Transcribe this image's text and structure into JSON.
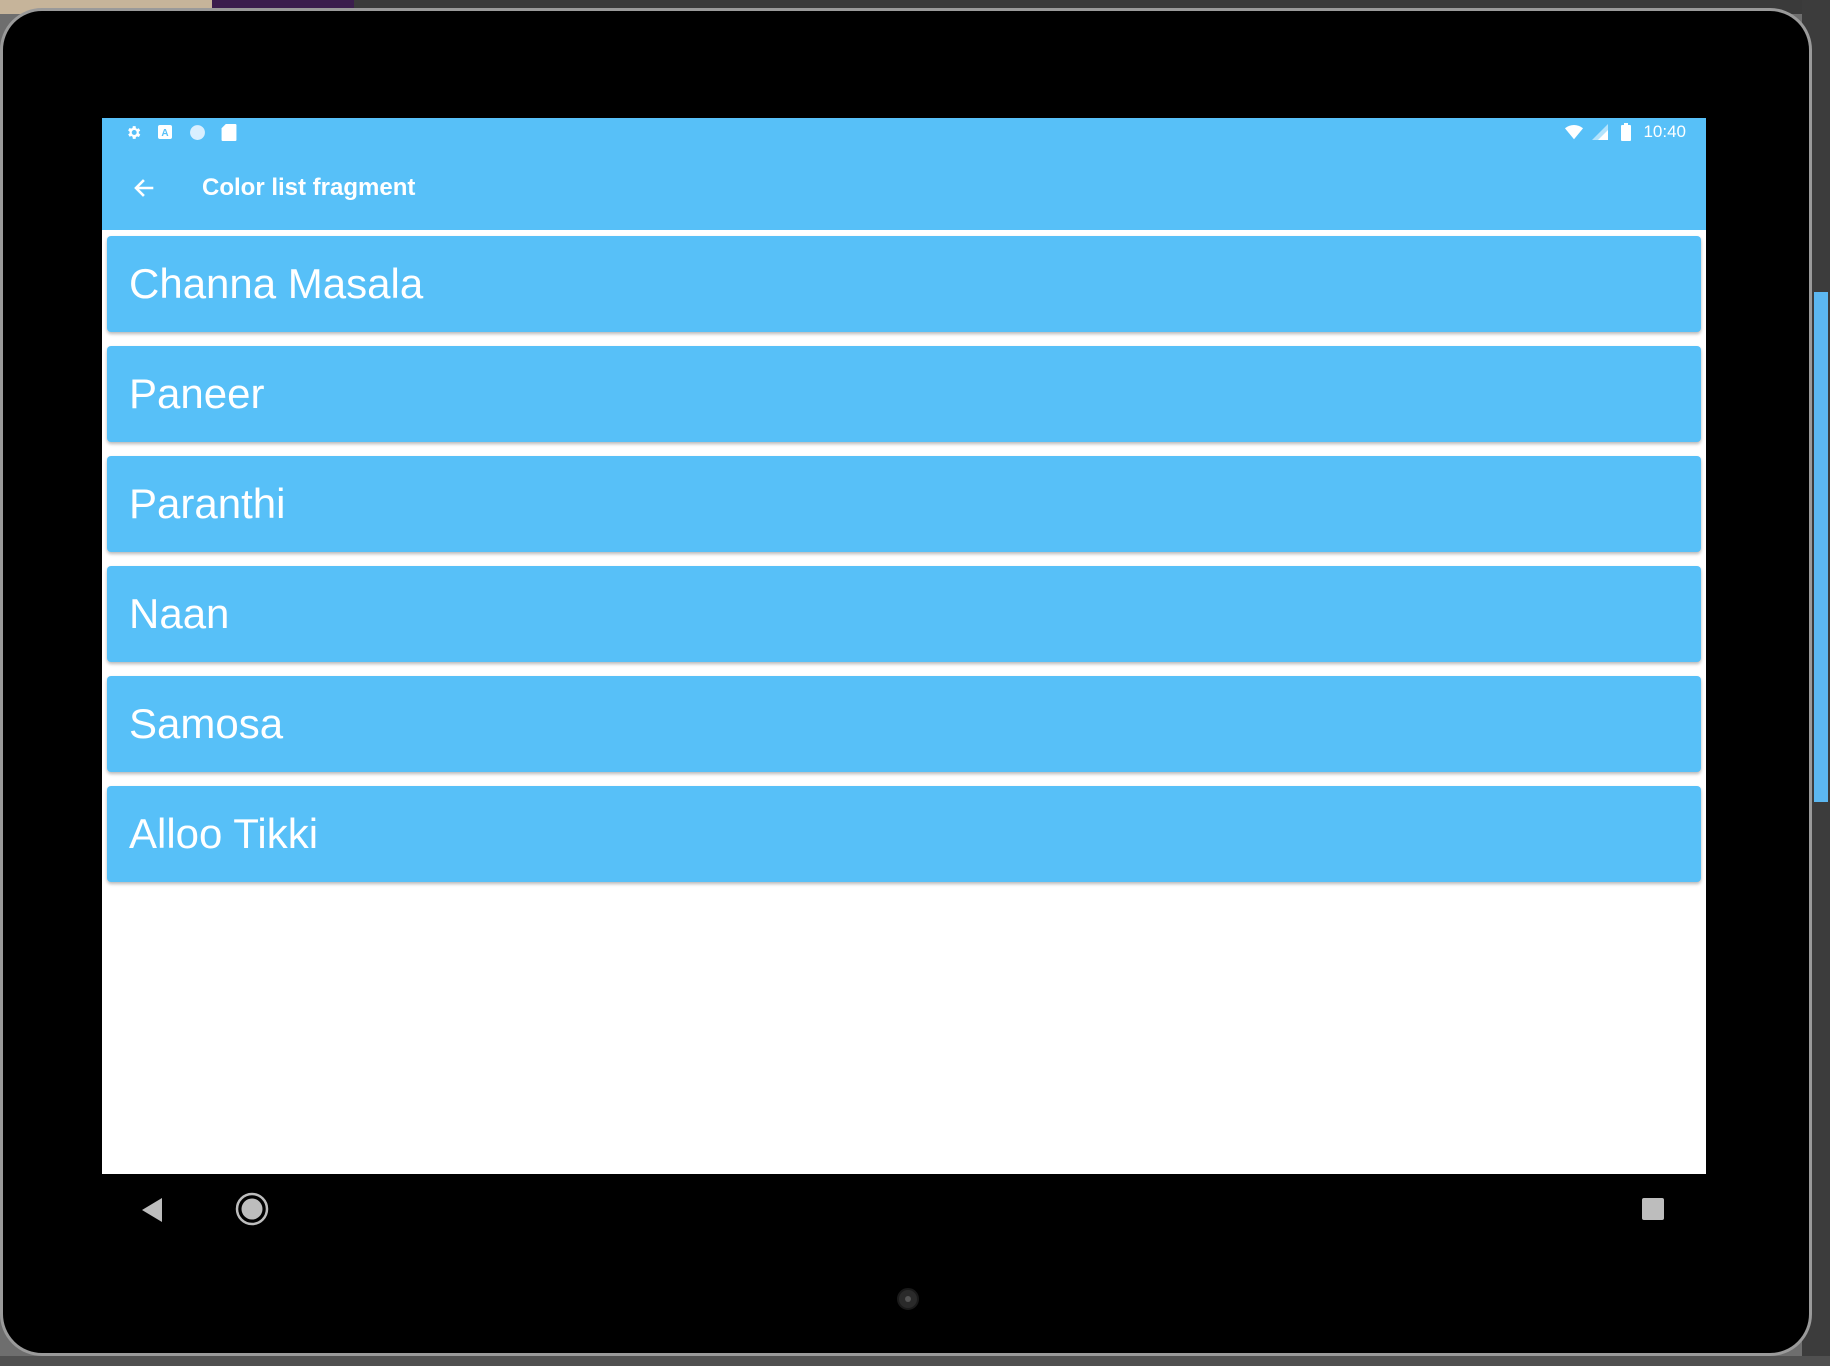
{
  "status_bar": {
    "left_icons": [
      "gear-icon",
      "a-notification-icon",
      "circle-icon",
      "sd-card-icon"
    ],
    "right_icons": [
      "wifi-icon",
      "cell-signal-icon",
      "battery-icon"
    ],
    "time": "10:40"
  },
  "toolbar": {
    "back_icon": "arrow-left-icon",
    "title": "Color list fragment"
  },
  "list": {
    "items": [
      {
        "label": "Channa Masala"
      },
      {
        "label": "Paneer"
      },
      {
        "label": "Paranthi"
      },
      {
        "label": "Naan"
      },
      {
        "label": "Samosa"
      },
      {
        "label": "Alloo Tikki"
      }
    ]
  },
  "nav_bar": {
    "icons": [
      "back-triangle-icon",
      "home-circle-icon",
      "recents-square-icon"
    ]
  },
  "colors": {
    "accent": "#57c0f8",
    "text": "#ffffff",
    "background": "#ffffff",
    "bezel": "#000000"
  }
}
